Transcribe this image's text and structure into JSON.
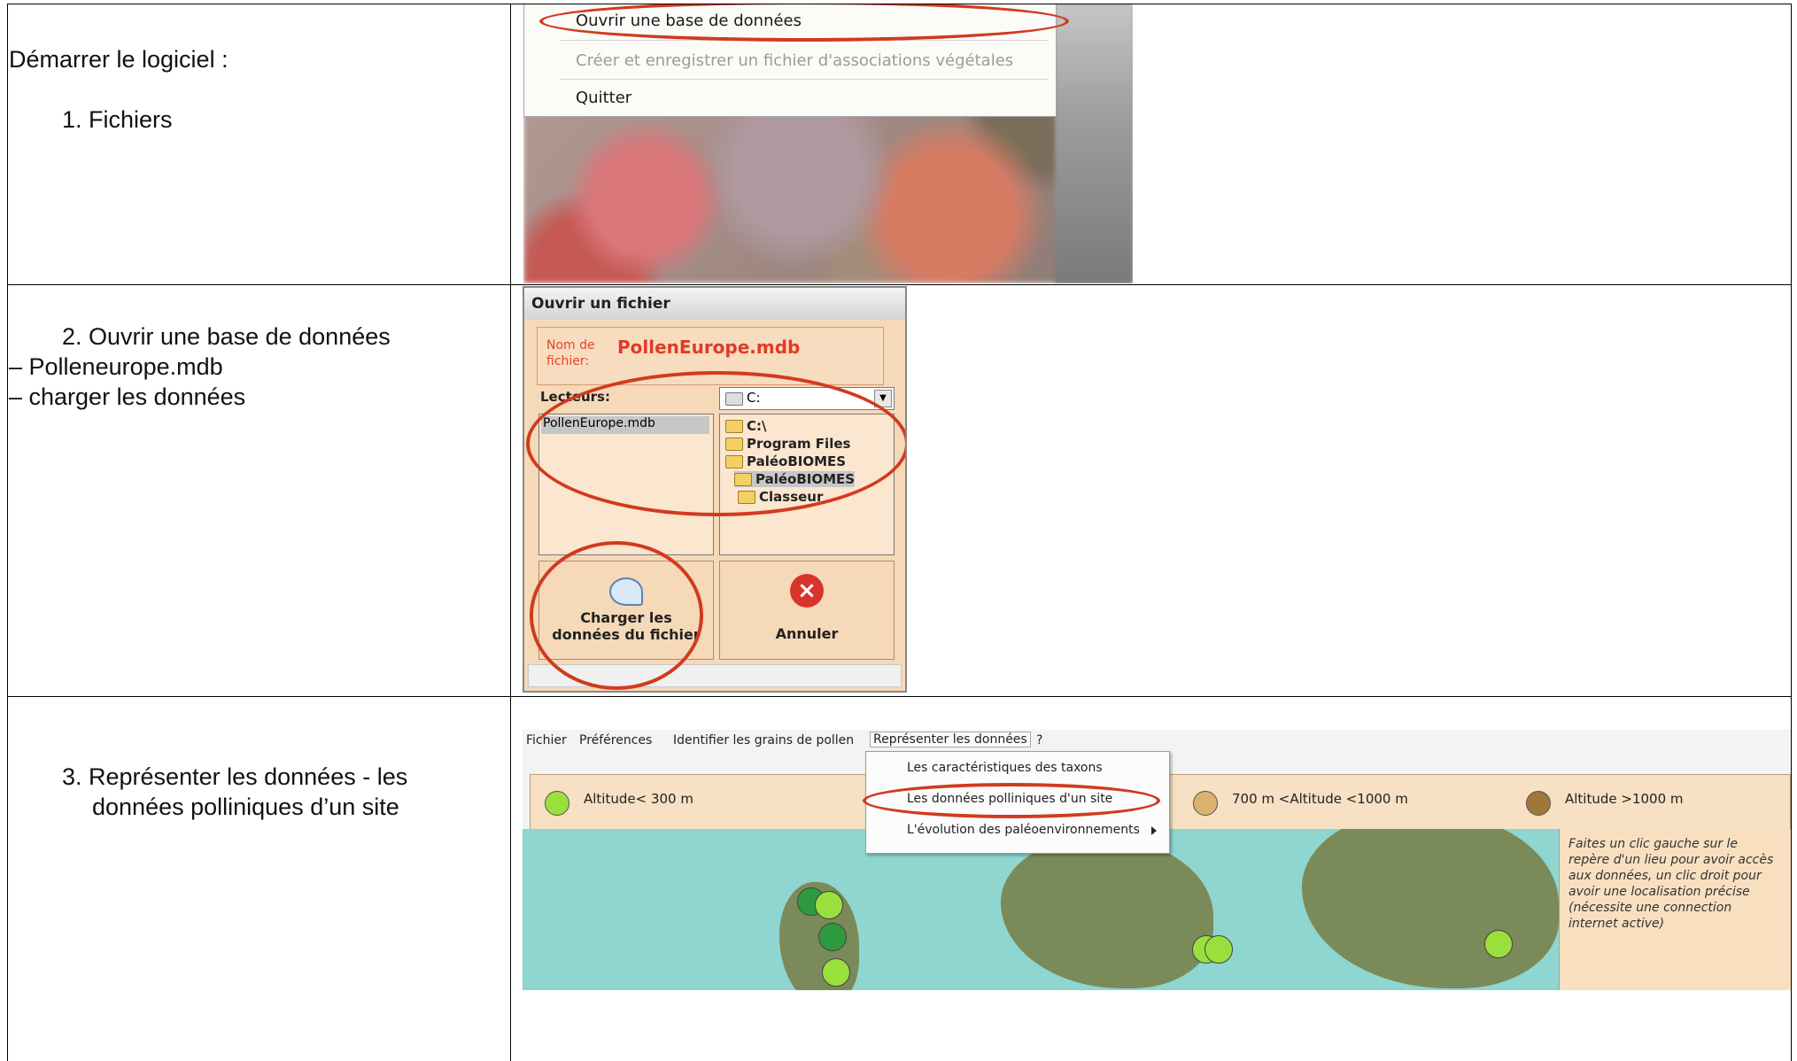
{
  "rows": [
    {
      "heading": "Démarrer le logiciel :",
      "step": "1.  Fichiers"
    },
    {
      "step": "2.  Ouvrir une base de données",
      "lines": [
        "– Polleneurope.mdb",
        "– charger les données"
      ]
    },
    {
      "step_line1": "3.  Représenter les données - les",
      "step_line2": "données polliniques d’un site"
    }
  ],
  "shot1": {
    "menu_items": [
      "Ouvrir une base de données",
      "Créer et enregistrer un fichier d'associations végétales",
      "Quitter"
    ]
  },
  "shot2": {
    "title": "Ouvrir un fichier",
    "field_label_1": "Nom de",
    "field_label_2": "fichier:",
    "file_name": "PollenEurope.mdb",
    "drives_label": "Lecteurs:",
    "drive_value": "C:",
    "file_list": [
      "PollenEurope.mdb"
    ],
    "dirs": [
      "C:\\",
      "Program Files",
      "PaléoBIOMES",
      "PaléoBIOMES",
      "Classeur"
    ],
    "load_button_1": "Charger les",
    "load_button_2": "données du fichier",
    "cancel_button": "Annuler"
  },
  "shot3": {
    "menubar": [
      "Fichier",
      "Préférences",
      "Identifier les grains de pollen",
      "Représenter les données",
      "?"
    ],
    "dropdown": [
      "Les caractéristiques des taxons",
      "Les données polliniques d'un site",
      "L'évolution des paléoenvironnements"
    ],
    "legend": [
      "Altitude< 300 m",
      "700 m <Altitude <1000 m",
      "Altitude >1000 m"
    ],
    "note": "Faites un clic gauche sur le repère d'un lieu pour avoir accès aux données, un clic droit pour avoir une localisation précise (nécessite une connection internet active)"
  },
  "colors": {
    "highlight": "#d23a1e",
    "dialog_bg": "#f5d9b8",
    "sea": "#8ed6cf",
    "alt_low": "#9ae03d",
    "alt_mid": "#d9b26b",
    "alt_high": "#a0773a",
    "alt_green": "#2e9a3e"
  }
}
